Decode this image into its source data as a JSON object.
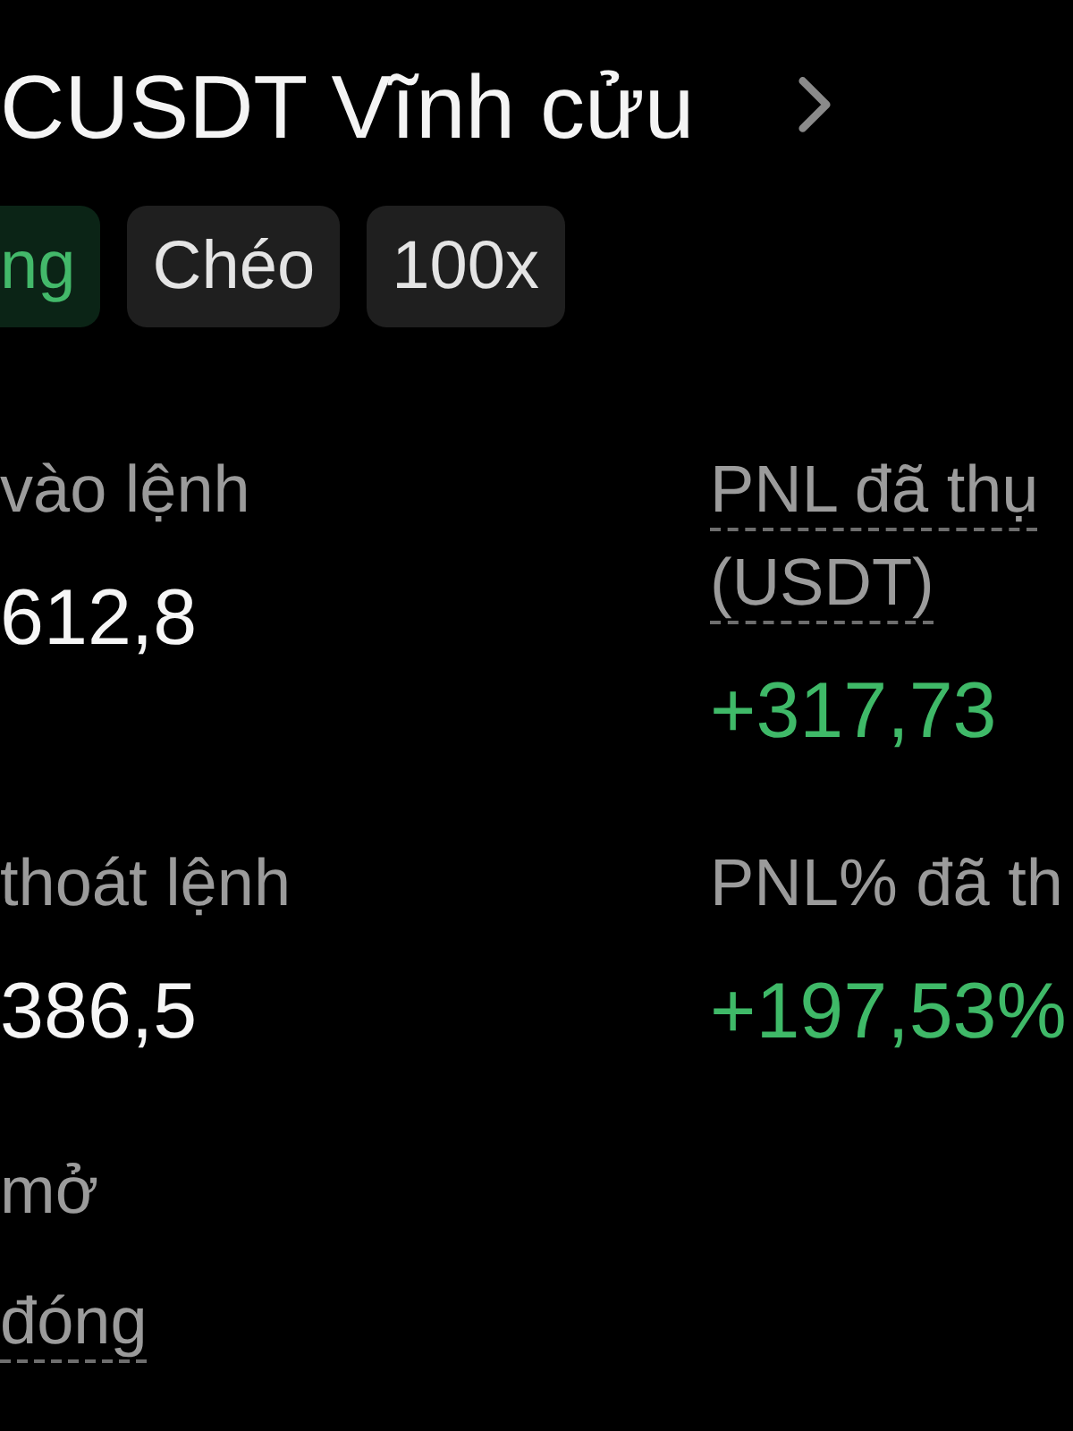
{
  "header": {
    "title": "CUSDT Vĩnh cửu"
  },
  "tags": [
    {
      "label": "ng",
      "kind": "side"
    },
    {
      "label": "Chéo",
      "kind": "mode"
    },
    {
      "label": "100x",
      "kind": "mode"
    }
  ],
  "stats": {
    "rows": [
      {
        "cells": [
          {
            "label": "vào lệnh",
            "hint": false,
            "value": "612,8",
            "kind": "plain"
          },
          {
            "label": "PNL đã thụ (USDT)",
            "hint": true,
            "value": "+317,73",
            "kind": "gain"
          }
        ]
      },
      {
        "cells": [
          {
            "label": "thoát lệnh",
            "hint": false,
            "value": "386,5",
            "kind": "plain"
          },
          {
            "label": "PNL% đã th",
            "hint": false,
            "value": "+197,53%",
            "kind": "gain"
          }
        ]
      }
    ]
  },
  "details": [
    {
      "label": "mở",
      "hint": false
    },
    {
      "label": "đóng",
      "hint": true
    }
  ]
}
